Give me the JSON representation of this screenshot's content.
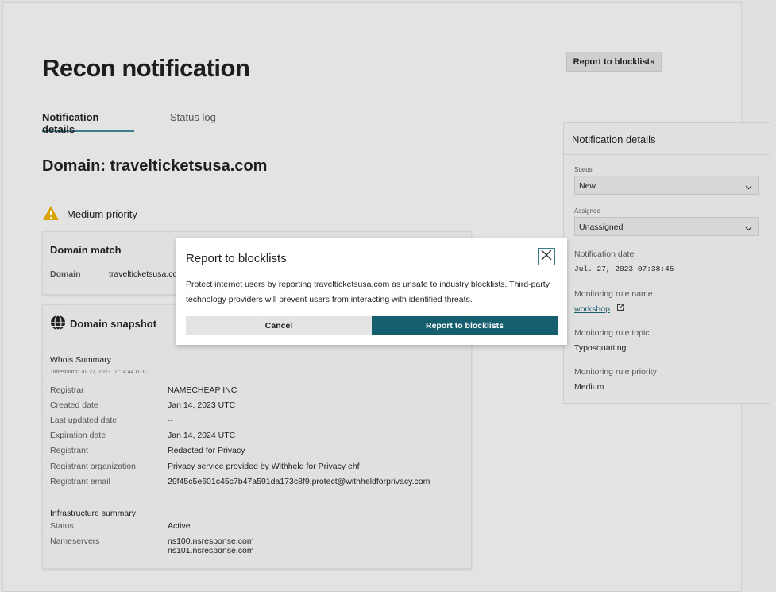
{
  "page": {
    "title": "Recon notification",
    "top_button_label": "Report to blocklists",
    "tabs": [
      {
        "label": "Notification details",
        "active": true
      },
      {
        "label": "Status log",
        "active": false
      }
    ],
    "domain_heading": "Domain: travelticketsusa.com",
    "priority": {
      "label": "Medium priority",
      "icon": "warning-icon",
      "color": "#d9a300"
    }
  },
  "domain_match": {
    "title": "Domain match",
    "label": "Domain",
    "value": "travelticketsusa.com"
  },
  "snapshot": {
    "title": "Domain snapshot",
    "icon": "globe-icon",
    "whois_title": "Whois Summary",
    "timestamp": "Timestamp: Jul 27, 2023 10:14:44 UTC",
    "rows": [
      {
        "label": "Registrar",
        "value": "NAMECHEAP INC"
      },
      {
        "label": "Created date",
        "value": "Jan 14, 2023 UTC"
      },
      {
        "label": "Last updated date",
        "value": "--"
      },
      {
        "label": "Expiration date",
        "value": "Jan 14, 2024 UTC"
      },
      {
        "label": "Registrant",
        "value": "Redacted for Privacy"
      },
      {
        "label": "Registrant organization",
        "value": "Privacy service provided by Withheld for Privacy ehf"
      },
      {
        "label": "Registrant email",
        "value": "29f45c5e601c45c7b47a591da173c8f9.protect@withheldforprivacy.com"
      }
    ],
    "infra_title": "Infrastructure summary",
    "status_label": "Status",
    "status_value": "Active",
    "nameservers_label": "Nameservers",
    "nameservers": [
      "ns100.nsresponse.com",
      "ns101.nsresponse.com"
    ]
  },
  "panel": {
    "title": "Notification details",
    "status_label": "Status",
    "status_value": "New",
    "assignee_label": "Assignee",
    "assignee_value": "Unassigned",
    "notification_date_label": "Notification date",
    "notification_date_value": "Jul. 27, 2023 07:38:45",
    "rule_name_label": "Monitoring rule name",
    "rule_name_value": "workshop",
    "rule_topic_label": "Monitoring rule topic",
    "rule_topic_value": "Typosquatting",
    "rule_priority_label": "Monitoring rule priority",
    "rule_priority_value": "Medium"
  },
  "modal": {
    "title": "Report to blocklists",
    "body": "Protect internet users by reporting travelticketsusa.com as unsafe to industry blocklists. Third-party technology providers will prevent users from interacting with identified threats.",
    "cancel_label": "Cancel",
    "confirm_label": "Report to blocklists",
    "accent_color": "#155e6e"
  }
}
